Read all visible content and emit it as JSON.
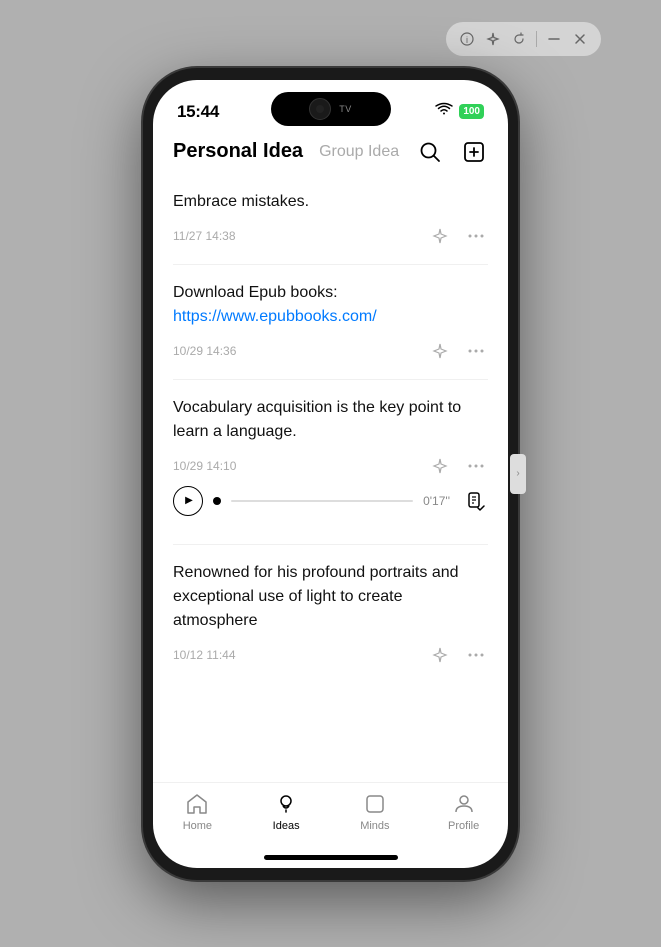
{
  "windowControls": {
    "buttons": [
      "circle-dot",
      "sparkle",
      "refresh",
      "minimize",
      "close"
    ]
  },
  "statusBar": {
    "time": "15:44",
    "wifi": "wifi",
    "battery": "100"
  },
  "header": {
    "tabPersonal": "Personal Idea",
    "tabGroup": "Group Idea",
    "searchLabel": "search",
    "composeLabel": "compose"
  },
  "ideas": [
    {
      "id": 1,
      "text": "Embrace mistakes.",
      "hasLink": false,
      "link": "",
      "linkText": "",
      "date": "11/27 14:38",
      "hasAudio": false
    },
    {
      "id": 2,
      "textBefore": "Download Epub books: ",
      "text": "Download Epub books: https://www.epubbooks.com/",
      "hasLink": true,
      "link": "https://www.epubbooks.com/",
      "linkText": "https://www.epubbooks.com/",
      "textPlain": "Download Epub books: ",
      "date": "10/29 14:36",
      "hasAudio": false
    },
    {
      "id": 3,
      "text": "Vocabulary acquisition is the key point to learn a language.",
      "hasLink": false,
      "link": "",
      "linkText": "",
      "date": "10/29 14:10",
      "hasAudio": true,
      "audioDuration": "0'17''"
    },
    {
      "id": 4,
      "text": "Renowned for his profound portraits and exceptional use of light to create atmosphere",
      "hasLink": false,
      "link": "",
      "linkText": "",
      "date": "10/12 11:44",
      "hasAudio": false
    }
  ],
  "nav": {
    "items": [
      {
        "id": "home",
        "label": "Home",
        "active": false
      },
      {
        "id": "ideas",
        "label": "Ideas",
        "active": true
      },
      {
        "id": "minds",
        "label": "Minds",
        "active": false
      },
      {
        "id": "profile",
        "label": "Profile",
        "active": false
      }
    ]
  }
}
